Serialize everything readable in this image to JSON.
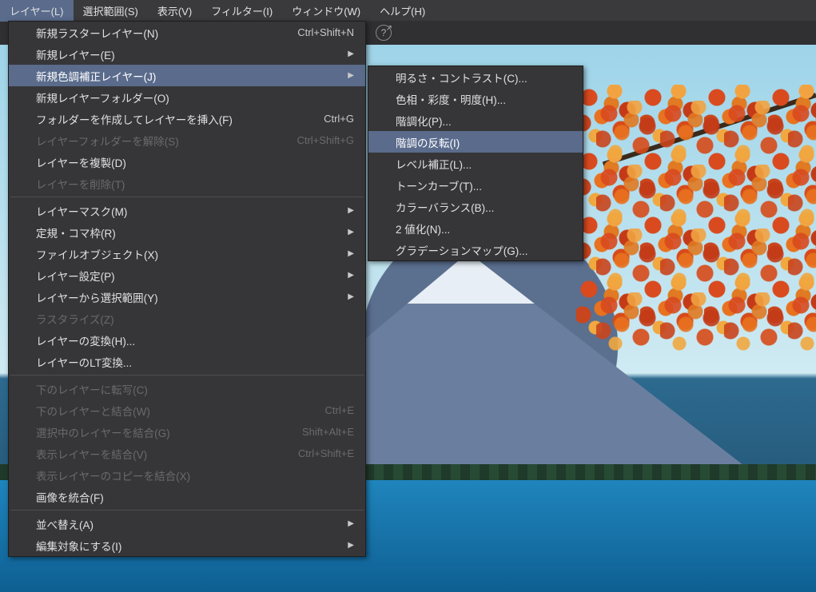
{
  "menubar": {
    "layer": "レイヤー(L)",
    "select": "選択範囲(S)",
    "view": "表示(V)",
    "filter": "フィルター(I)",
    "window": "ウィンドウ(W)",
    "help": "ヘルプ(H)"
  },
  "layerMenu": {
    "newRaster": {
      "label": "新規ラスターレイヤー(N)",
      "shortcut": "Ctrl+Shift+N"
    },
    "newLayer": {
      "label": "新規レイヤー(E)"
    },
    "newCorrection": {
      "label": "新規色調補正レイヤー(J)"
    },
    "newFolder": {
      "label": "新規レイヤーフォルダー(O)"
    },
    "insertFolder": {
      "label": "フォルダーを作成してレイヤーを挿入(F)",
      "shortcut": "Ctrl+G"
    },
    "ungroupFolder": {
      "label": "レイヤーフォルダーを解除(S)",
      "shortcut": "Ctrl+Shift+G"
    },
    "duplicate": {
      "label": "レイヤーを複製(D)"
    },
    "delete": {
      "label": "レイヤーを削除(T)"
    },
    "mask": {
      "label": "レイヤーマスク(M)"
    },
    "rulerFrame": {
      "label": "定規・コマ枠(R)"
    },
    "fileObject": {
      "label": "ファイルオブジェクト(X)"
    },
    "settings": {
      "label": "レイヤー設定(P)"
    },
    "fromSelection": {
      "label": "レイヤーから選択範囲(Y)"
    },
    "rasterize": {
      "label": "ラスタライズ(Z)"
    },
    "convert": {
      "label": "レイヤーの変換(H)..."
    },
    "ltConvert": {
      "label": "レイヤーのLT変換..."
    },
    "transferBelow": {
      "label": "下のレイヤーに転写(C)"
    },
    "mergeBelow": {
      "label": "下のレイヤーと結合(W)",
      "shortcut": "Ctrl+E"
    },
    "mergeSelected": {
      "label": "選択中のレイヤーを結合(G)",
      "shortcut": "Shift+Alt+E"
    },
    "mergeVisible": {
      "label": "表示レイヤーを結合(V)",
      "shortcut": "Ctrl+Shift+E"
    },
    "mergeVisibleCopy": {
      "label": "表示レイヤーのコピーを結合(X)"
    },
    "flatten": {
      "label": "画像を統合(F)"
    },
    "arrange": {
      "label": "並べ替え(A)"
    },
    "editTarget": {
      "label": "編集対象にする(I)"
    }
  },
  "correctionSubmenu": {
    "brightContrast": "明るさ・コントラスト(C)...",
    "hueSatLight": "色相・彩度・明度(H)...",
    "posterize": "階調化(P)...",
    "invert": "階調の反転(I)",
    "levels": "レベル補正(L)...",
    "curves": "トーンカーブ(T)...",
    "colorBalance": "カラーバランス(B)...",
    "binarize": "2 値化(N)...",
    "gradMap": "グラデーションマップ(G)..."
  }
}
